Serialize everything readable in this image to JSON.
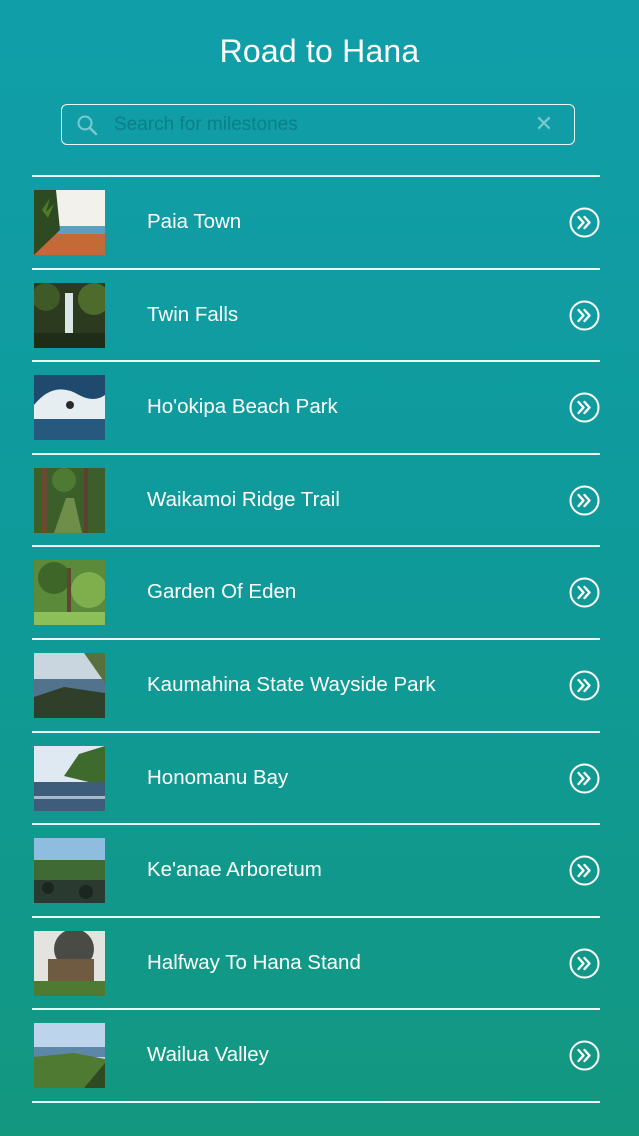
{
  "header": {
    "title": "Road to Hana"
  },
  "search": {
    "placeholder": "Search for milestones",
    "value": "",
    "icon": "search-icon",
    "clear_icon": "close-icon",
    "clear_glyph": "✕"
  },
  "milestones": {
    "items": [
      {
        "label": "Paia Town",
        "thumb": "paia"
      },
      {
        "label": "Twin Falls",
        "thumb": "falls"
      },
      {
        "label": "Ho'okipa Beach Park",
        "thumb": "wave"
      },
      {
        "label": "Waikamoi Ridge Trail",
        "thumb": "forest"
      },
      {
        "label": "Garden Of Eden",
        "thumb": "garden"
      },
      {
        "label": "Kaumahina State Wayside Park",
        "thumb": "coast"
      },
      {
        "label": "Honomanu Bay",
        "thumb": "bay"
      },
      {
        "label": "Ke'anae Arboretum",
        "thumb": "arboretum"
      },
      {
        "label": "Halfway To Hana Stand",
        "thumb": "stand"
      },
      {
        "label": "Wailua Valley",
        "thumb": "valley"
      }
    ],
    "row_icon": "chevron-double-right-icon"
  },
  "colors": {
    "background_top": "#109ea9",
    "background_bottom": "#13977f",
    "foreground": "#ffffff"
  }
}
